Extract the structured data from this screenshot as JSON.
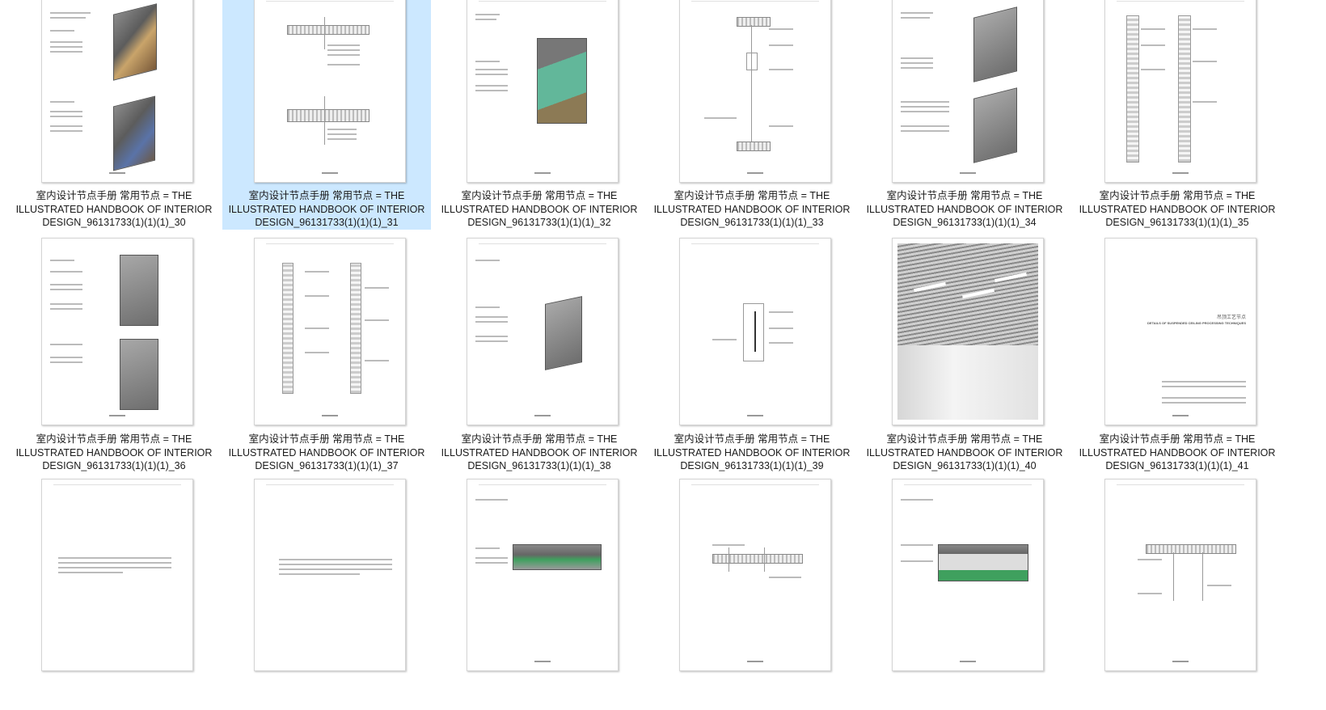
{
  "selected_index": 1,
  "items": [
    {
      "caption": "室内设计节点手册  常用节点  =  THE ILLUSTRATED HANDBOOK OF INTERIOR DESIGN_96131733(1)(1)(1)_30"
    },
    {
      "caption": "室内设计节点手册  常用节点  =  THE ILLUSTRATED HANDBOOK OF INTERIOR DESIGN_96131733(1)(1)(1)_31"
    },
    {
      "caption": "室内设计节点手册  常用节点  =  THE ILLUSTRATED HANDBOOK OF INTERIOR DESIGN_96131733(1)(1)(1)_32"
    },
    {
      "caption": "室内设计节点手册  常用节点  =  THE ILLUSTRATED HANDBOOK OF INTERIOR DESIGN_96131733(1)(1)(1)_33"
    },
    {
      "caption": "室内设计节点手册  常用节点  =  THE ILLUSTRATED HANDBOOK OF INTERIOR DESIGN_96131733(1)(1)(1)_34"
    },
    {
      "caption": "室内设计节点手册  常用节点  =  THE ILLUSTRATED HANDBOOK OF INTERIOR DESIGN_96131733(1)(1)(1)_35"
    },
    {
      "caption": "室内设计节点手册  常用节点  =  THE ILLUSTRATED HANDBOOK OF INTERIOR DESIGN_96131733(1)(1)(1)_36"
    },
    {
      "caption": "室内设计节点手册  常用节点  =  THE ILLUSTRATED HANDBOOK OF INTERIOR DESIGN_96131733(1)(1)(1)_37"
    },
    {
      "caption": "室内设计节点手册  常用节点  =  THE ILLUSTRATED HANDBOOK OF INTERIOR DESIGN_96131733(1)(1)(1)_38"
    },
    {
      "caption": "室内设计节点手册  常用节点  =  THE ILLUSTRATED HANDBOOK OF INTERIOR DESIGN_96131733(1)(1)(1)_39"
    },
    {
      "caption": "室内设计节点手册  常用节点  =  THE ILLUSTRATED HANDBOOK OF INTERIOR DESIGN_96131733(1)(1)(1)_40"
    },
    {
      "caption": "室内设计节点手册  常用节点  =  THE ILLUSTRATED HANDBOOK OF INTERIOR DESIGN_96131733(1)(1)(1)_41"
    },
    {
      "caption": ""
    },
    {
      "caption": ""
    },
    {
      "caption": ""
    },
    {
      "caption": ""
    },
    {
      "caption": ""
    },
    {
      "caption": ""
    }
  ],
  "page_41_heading": "吊顶工艺节点",
  "page_41_subheading": "DETAILS OF SUSPENDED CEILING PROCESSING TECHNIQUES",
  "colors": {
    "selection": "#cce8ff"
  }
}
